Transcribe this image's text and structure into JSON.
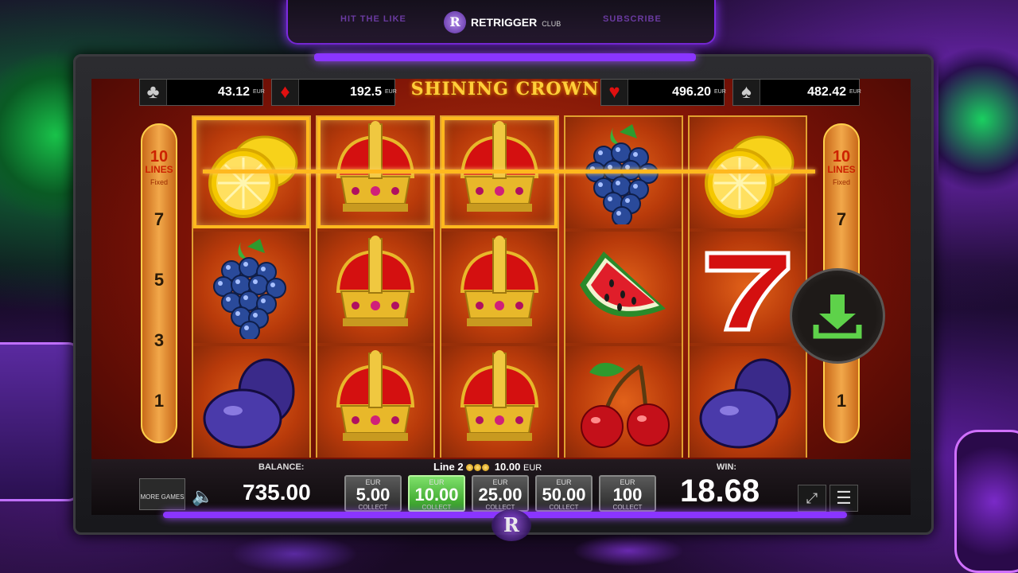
{
  "overlay": {
    "left_link": "HIT THE LIKE",
    "right_link": "SUBSCRIBE",
    "brand_logo_letter": "R",
    "brand_name": "RETRIGGER",
    "brand_suffix": "CLUB"
  },
  "game": {
    "title": "SHINING CROWN",
    "jackpots": [
      {
        "suit": "♣",
        "suit_color": "#cccccc",
        "value": "43.12",
        "currency": "EUR"
      },
      {
        "suit": "♦",
        "suit_color": "#e01010",
        "value": "192.5",
        "currency": "EUR"
      },
      {
        "suit": "♥",
        "suit_color": "#e01010",
        "value": "496.20",
        "currency": "EUR"
      },
      {
        "suit": "♠",
        "suit_color": "#cccccc",
        "value": "482.42",
        "currency": "EUR"
      }
    ],
    "side_panel": {
      "lines_count": "10",
      "lines_label": "LINES",
      "fixed_label": "Fixed",
      "line_numbers": [
        "7",
        "5",
        "3",
        "1"
      ]
    },
    "reels": [
      [
        "lemon",
        "grapes",
        "plum"
      ],
      [
        "crown",
        "crown",
        "crown"
      ],
      [
        "crown",
        "crown",
        "crown"
      ],
      [
        "grapes",
        "watermelon",
        "cherries"
      ],
      [
        "lemon",
        "seven",
        "plum"
      ]
    ],
    "winning_cells": [
      [
        0,
        0
      ],
      [
        1,
        0
      ],
      [
        2,
        0
      ]
    ],
    "download_icon": "download-arrow-icon"
  },
  "bottom_bar": {
    "balance_label": "BALANCE:",
    "balance_value": "735.00",
    "line_label": "Line 2",
    "line_amount": "10.00",
    "line_currency": "EUR",
    "more_games_label": "MORE GAMES",
    "sound_icon": "speaker-icon",
    "win_label": "WIN:",
    "win_value": "18.68",
    "stakes": [
      {
        "currency": "EUR",
        "amount": "5.00",
        "action": "COLLECT",
        "active": false
      },
      {
        "currency": "EUR",
        "amount": "10.00",
        "action": "COLLECT",
        "active": true
      },
      {
        "currency": "EUR",
        "amount": "25.00",
        "action": "COLLECT",
        "active": false
      },
      {
        "currency": "EUR",
        "amount": "50.00",
        "action": "COLLECT",
        "active": false
      },
      {
        "currency": "EUR",
        "amount": "100",
        "action": "COLLECT",
        "active": false
      }
    ],
    "fullscreen_icon": "fullscreen-icon",
    "menu_icon": "hamburger-menu-icon"
  },
  "colors": {
    "accent_purple": "#8a35ff",
    "win_gold": "#ffb81e",
    "active_stake": "#2f9a20"
  }
}
